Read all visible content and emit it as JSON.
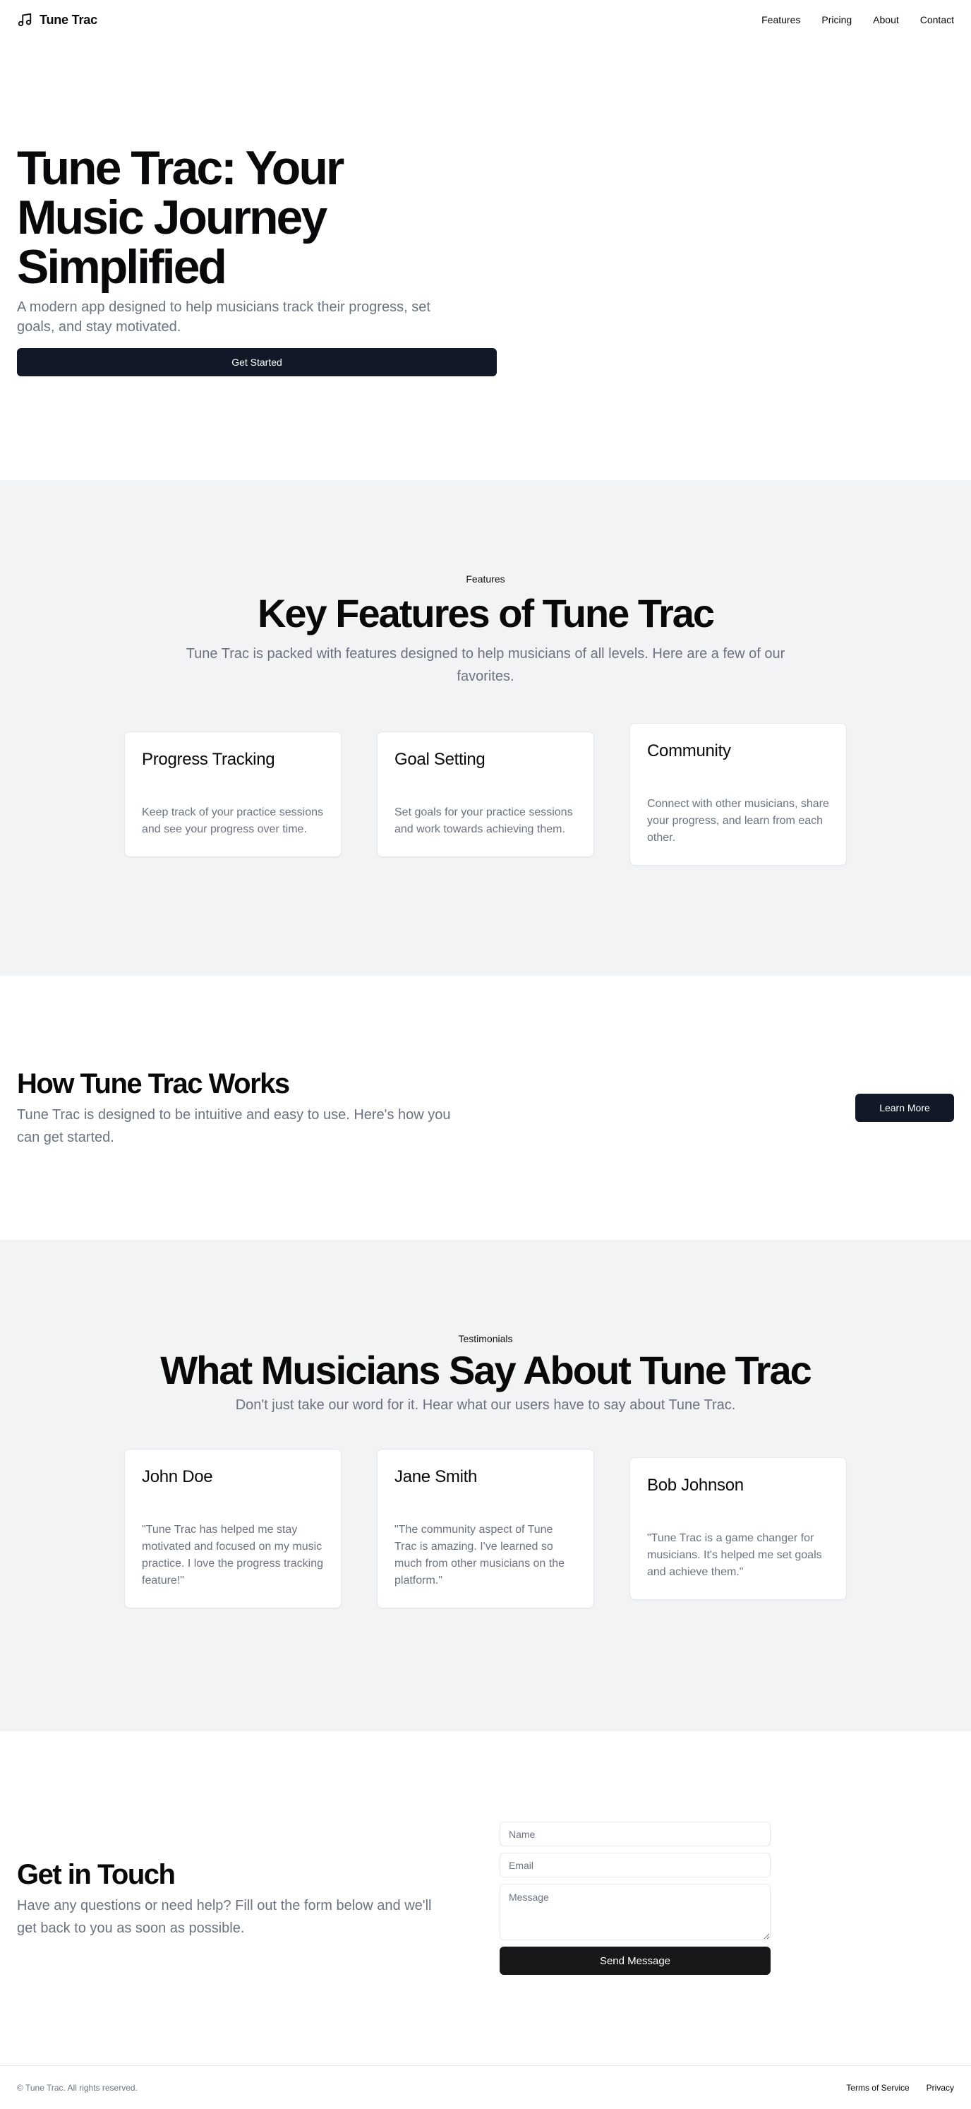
{
  "header": {
    "brand": "Tune Trac",
    "brand_icon": "music-note-icon",
    "nav": [
      "Features",
      "Pricing",
      "About",
      "Contact"
    ]
  },
  "hero": {
    "title": "Tune Trac: Your Music Journey Simplified",
    "subtitle": "A modern app designed to help musicians track their progress, set goals, and stay motivated.",
    "cta": "Get Started"
  },
  "features": {
    "eyebrow": "Features",
    "title": "Key Features of Tune Trac",
    "description": "Tune Trac is packed with features designed to help musicians of all levels. Here are a few of our favorites.",
    "cards": [
      {
        "title": "Progress Tracking",
        "text": "Keep track of your practice sessions and see your progress over time."
      },
      {
        "title": "Goal Setting",
        "text": "Set goals for your practice sessions and work towards achieving them."
      },
      {
        "title": "Community",
        "text": "Connect with other musicians, share your progress, and learn from each other."
      }
    ]
  },
  "how": {
    "title": "How Tune Trac Works",
    "description": "Tune Trac is designed to be intuitive and easy to use. Here's how you can get started.",
    "cta": "Learn More"
  },
  "testimonials": {
    "eyebrow": "Testimonials",
    "title": "What Musicians Say About Tune Trac",
    "description": "Don't just take our word for it. Hear what our users have to say about Tune Trac.",
    "cards": [
      {
        "name": "John Doe",
        "quote": "\"Tune Trac has helped me stay motivated and focused on my music practice. I love the progress tracking feature!\""
      },
      {
        "name": "Jane Smith",
        "quote": "\"The community aspect of Tune Trac is amazing. I've learned so much from other musicians on the platform.\""
      },
      {
        "name": "Bob Johnson",
        "quote": "\"Tune Trac is a game changer for musicians. It's helped me set goals and achieve them.\""
      }
    ]
  },
  "contact": {
    "title": "Get in Touch",
    "description": "Have any questions or need help? Fill out the form below and we'll get back to you as soon as possible.",
    "name_placeholder": "Name",
    "email_placeholder": "Email",
    "message_placeholder": "Message",
    "submit": "Send Message"
  },
  "footer": {
    "copyright": "© Tune Trac. All rights reserved.",
    "links": [
      "Terms of Service",
      "Privacy"
    ]
  }
}
